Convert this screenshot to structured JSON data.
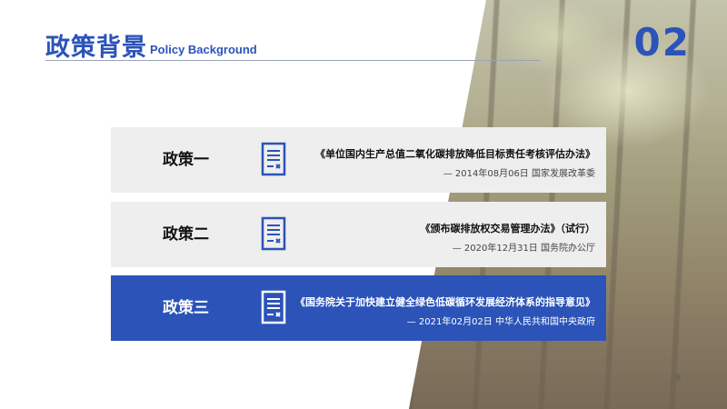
{
  "header": {
    "title_zh": "政策背景",
    "title_en": "Policy Background",
    "section_number": "02"
  },
  "policies": [
    {
      "label": "政策一",
      "title": "《单位国内生产总值二氧化碳排放降低目标责任考核评估办法》",
      "source": "— 2014年08月06日 国家发展改革委",
      "highlighted": false
    },
    {
      "label": "政策二",
      "title": "《颁布碳排放权交易管理办法》（试行）",
      "source": "— 2020年12月31日 国务院办公厅",
      "highlighted": false
    },
    {
      "label": "政策三",
      "title": "《国务院关于加快建立健全绿色低碳循环发展经济体系的指导意见》",
      "source": "— 2021年02月02日 中华人民共和国中央政府",
      "highlighted": true
    }
  ],
  "footer": {
    "slide_number": "6"
  },
  "colors": {
    "accent": "#2b53b8",
    "card_bg": "#eeeeee"
  },
  "icons": {
    "policy_document": "document-x-icon"
  }
}
